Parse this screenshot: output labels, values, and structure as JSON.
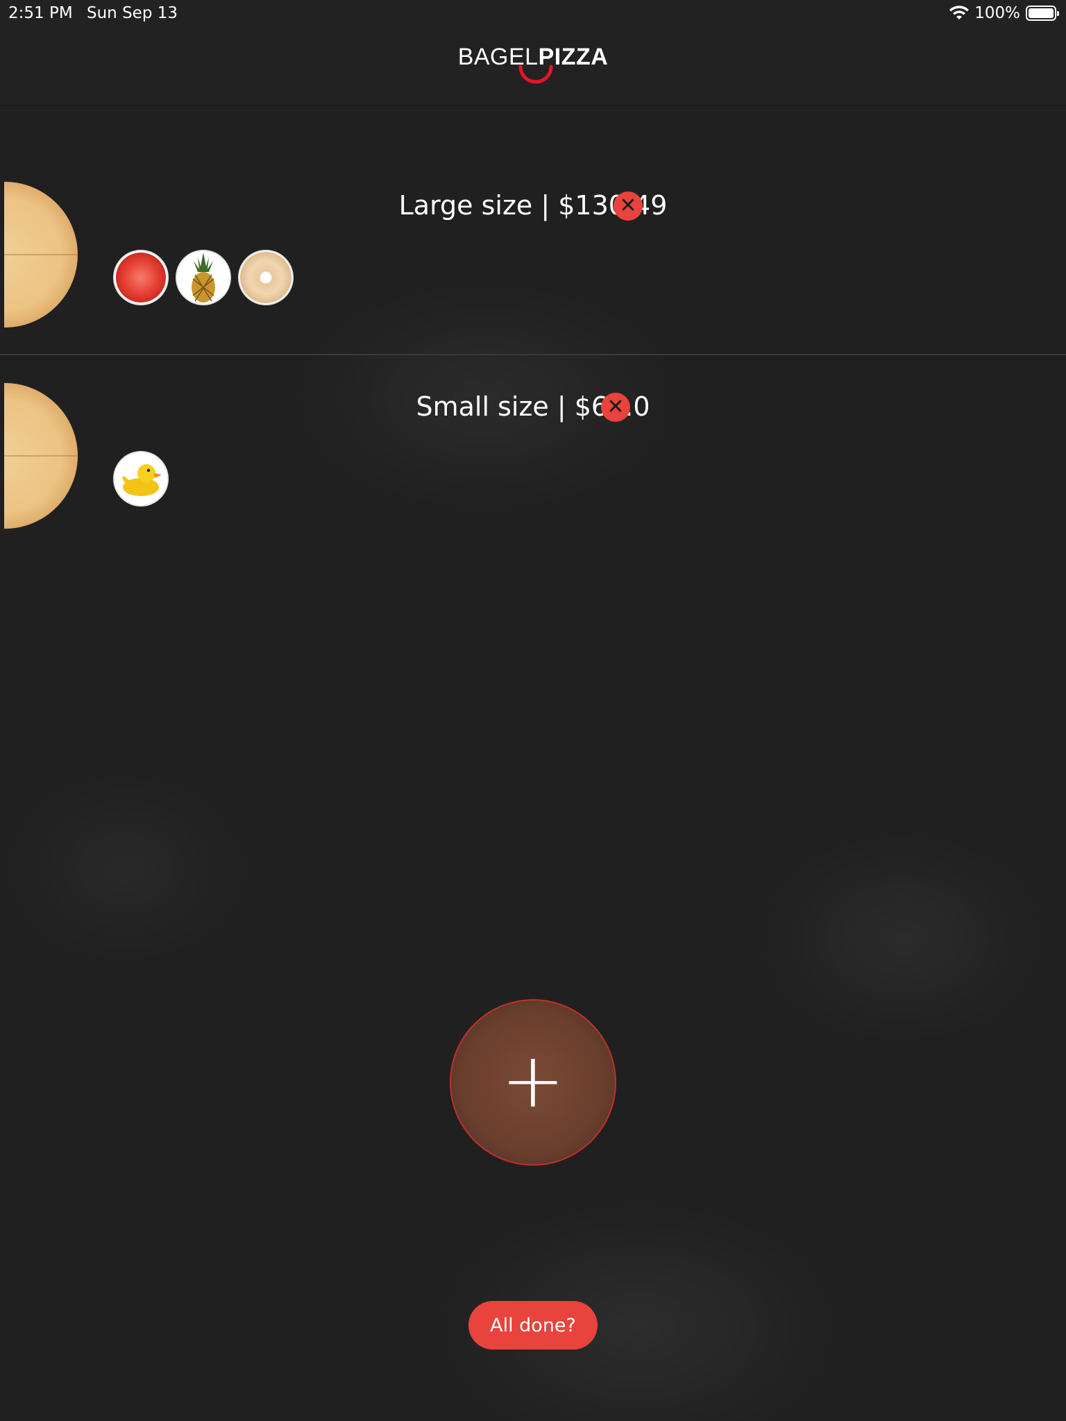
{
  "status_bar": {
    "time": "2:51 PM",
    "date": "Sun Sep 13",
    "battery": "100%"
  },
  "nav": {
    "logo_light": "BAGEL",
    "logo_bold": "PIZZA"
  },
  "orders": [
    {
      "title": "Large size | $130.49",
      "toppings": [
        "tomato-icon",
        "pineapple-icon",
        "bagel-icon"
      ]
    },
    {
      "title": "Small size | $63.0",
      "toppings": [
        "rubber-duck-icon"
      ]
    }
  ],
  "add_button": {
    "label": "+"
  },
  "done_button": {
    "label": "All done?"
  },
  "colors": {
    "accent": "#e8433c",
    "background": "#202020",
    "bar": "#222222"
  }
}
